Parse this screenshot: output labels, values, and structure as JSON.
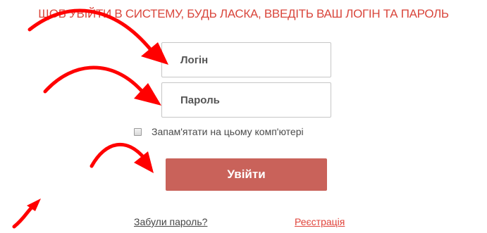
{
  "instruction": "ЩОБ УВІЙТИ В СИСТЕМУ, БУДЬ ЛАСКА, ВВЕДІТЬ ВАШ ЛОГІН ТА ПАРОЛЬ",
  "form": {
    "login_placeholder": "Логін",
    "password_placeholder": "Пароль",
    "remember_label": "Запам'ятати на цьому комп'ютері",
    "submit_label": "Увійти"
  },
  "links": {
    "forgot_password": "Забули пароль?",
    "register": "Реєстрація"
  },
  "colors": {
    "accent_red": "#d9463c",
    "button": "#c9625a",
    "arrow": "#ff0000"
  },
  "annotations": {
    "arrow_count": 4
  }
}
